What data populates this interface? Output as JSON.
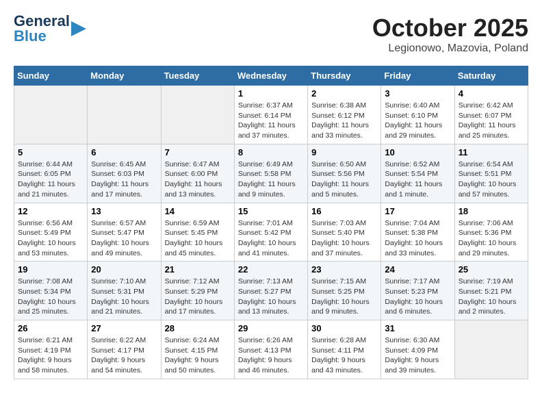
{
  "header": {
    "logo_line1": "General",
    "logo_line2": "Blue",
    "month": "October 2025",
    "location": "Legionowo, Mazovia, Poland"
  },
  "weekdays": [
    "Sunday",
    "Monday",
    "Tuesday",
    "Wednesday",
    "Thursday",
    "Friday",
    "Saturday"
  ],
  "weeks": [
    [
      {
        "day": "",
        "empty": true
      },
      {
        "day": "",
        "empty": true
      },
      {
        "day": "",
        "empty": true
      },
      {
        "day": "1",
        "sunrise": "6:37 AM",
        "sunset": "6:14 PM",
        "daylight": "11 hours and 37 minutes."
      },
      {
        "day": "2",
        "sunrise": "6:38 AM",
        "sunset": "6:12 PM",
        "daylight": "11 hours and 33 minutes."
      },
      {
        "day": "3",
        "sunrise": "6:40 AM",
        "sunset": "6:10 PM",
        "daylight": "11 hours and 29 minutes."
      },
      {
        "day": "4",
        "sunrise": "6:42 AM",
        "sunset": "6:07 PM",
        "daylight": "11 hours and 25 minutes."
      }
    ],
    [
      {
        "day": "5",
        "sunrise": "6:44 AM",
        "sunset": "6:05 PM",
        "daylight": "11 hours and 21 minutes."
      },
      {
        "day": "6",
        "sunrise": "6:45 AM",
        "sunset": "6:03 PM",
        "daylight": "11 hours and 17 minutes."
      },
      {
        "day": "7",
        "sunrise": "6:47 AM",
        "sunset": "6:00 PM",
        "daylight": "11 hours and 13 minutes."
      },
      {
        "day": "8",
        "sunrise": "6:49 AM",
        "sunset": "5:58 PM",
        "daylight": "11 hours and 9 minutes."
      },
      {
        "day": "9",
        "sunrise": "6:50 AM",
        "sunset": "5:56 PM",
        "daylight": "11 hours and 5 minutes."
      },
      {
        "day": "10",
        "sunrise": "6:52 AM",
        "sunset": "5:54 PM",
        "daylight": "11 hours and 1 minute."
      },
      {
        "day": "11",
        "sunrise": "6:54 AM",
        "sunset": "5:51 PM",
        "daylight": "10 hours and 57 minutes."
      }
    ],
    [
      {
        "day": "12",
        "sunrise": "6:56 AM",
        "sunset": "5:49 PM",
        "daylight": "10 hours and 53 minutes."
      },
      {
        "day": "13",
        "sunrise": "6:57 AM",
        "sunset": "5:47 PM",
        "daylight": "10 hours and 49 minutes."
      },
      {
        "day": "14",
        "sunrise": "6:59 AM",
        "sunset": "5:45 PM",
        "daylight": "10 hours and 45 minutes."
      },
      {
        "day": "15",
        "sunrise": "7:01 AM",
        "sunset": "5:42 PM",
        "daylight": "10 hours and 41 minutes."
      },
      {
        "day": "16",
        "sunrise": "7:03 AM",
        "sunset": "5:40 PM",
        "daylight": "10 hours and 37 minutes."
      },
      {
        "day": "17",
        "sunrise": "7:04 AM",
        "sunset": "5:38 PM",
        "daylight": "10 hours and 33 minutes."
      },
      {
        "day": "18",
        "sunrise": "7:06 AM",
        "sunset": "5:36 PM",
        "daylight": "10 hours and 29 minutes."
      }
    ],
    [
      {
        "day": "19",
        "sunrise": "7:08 AM",
        "sunset": "5:34 PM",
        "daylight": "10 hours and 25 minutes."
      },
      {
        "day": "20",
        "sunrise": "7:10 AM",
        "sunset": "5:31 PM",
        "daylight": "10 hours and 21 minutes."
      },
      {
        "day": "21",
        "sunrise": "7:12 AM",
        "sunset": "5:29 PM",
        "daylight": "10 hours and 17 minutes."
      },
      {
        "day": "22",
        "sunrise": "7:13 AM",
        "sunset": "5:27 PM",
        "daylight": "10 hours and 13 minutes."
      },
      {
        "day": "23",
        "sunrise": "7:15 AM",
        "sunset": "5:25 PM",
        "daylight": "10 hours and 9 minutes."
      },
      {
        "day": "24",
        "sunrise": "7:17 AM",
        "sunset": "5:23 PM",
        "daylight": "10 hours and 6 minutes."
      },
      {
        "day": "25",
        "sunrise": "7:19 AM",
        "sunset": "5:21 PM",
        "daylight": "10 hours and 2 minutes."
      }
    ],
    [
      {
        "day": "26",
        "sunrise": "6:21 AM",
        "sunset": "4:19 PM",
        "daylight": "9 hours and 58 minutes."
      },
      {
        "day": "27",
        "sunrise": "6:22 AM",
        "sunset": "4:17 PM",
        "daylight": "9 hours and 54 minutes."
      },
      {
        "day": "28",
        "sunrise": "6:24 AM",
        "sunset": "4:15 PM",
        "daylight": "9 hours and 50 minutes."
      },
      {
        "day": "29",
        "sunrise": "6:26 AM",
        "sunset": "4:13 PM",
        "daylight": "9 hours and 46 minutes."
      },
      {
        "day": "30",
        "sunrise": "6:28 AM",
        "sunset": "4:11 PM",
        "daylight": "9 hours and 43 minutes."
      },
      {
        "day": "31",
        "sunrise": "6:30 AM",
        "sunset": "4:09 PM",
        "daylight": "9 hours and 39 minutes."
      },
      {
        "day": "",
        "empty": true
      }
    ]
  ]
}
